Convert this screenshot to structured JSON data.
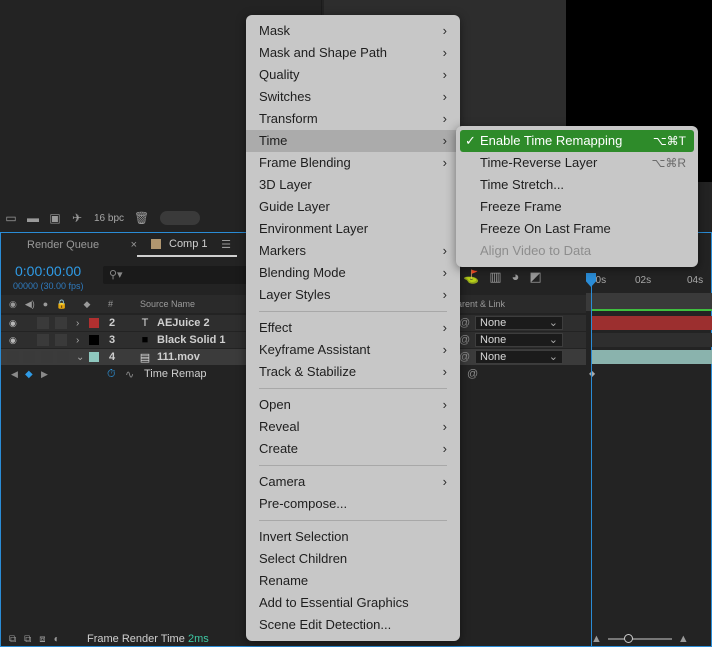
{
  "colors": {
    "accent_blue": "#2a8cd6",
    "menu_bg": "#c7c7c7",
    "highlight_green": "#2e8b2a",
    "label_red": "#b03030",
    "label_black": "#000000",
    "label_teal": "#8fc8bf"
  },
  "project_toolbar": {
    "bpc_label": "16 bpc"
  },
  "timeline": {
    "tabs": {
      "render_queue": "Render Queue",
      "comp": "Comp 1",
      "close_glyph": "×",
      "menu_glyph": "☰"
    },
    "timecode": "0:00:00:00",
    "fps": "00000 (30.00 fps)",
    "search_placeholder": "",
    "column_headers": {
      "number": "#",
      "source_name": "Source Name",
      "parent": "arent & Link"
    },
    "layers": [
      {
        "number": "2",
        "type_glyph": "T",
        "name": "AEJuice 2",
        "parent": "None"
      },
      {
        "number": "3",
        "type_glyph": "■",
        "name": "Black Solid 1",
        "parent": "None"
      },
      {
        "number": "4",
        "type_glyph": "▤",
        "name": "111.mov",
        "parent": "None"
      }
    ],
    "property_row": {
      "name": "Time Remap"
    },
    "ruler": [
      "00s",
      "02s",
      "04s"
    ],
    "footer": {
      "frame_render_label": "Frame Render Time",
      "frame_render_value": "2ms"
    }
  },
  "context_menu": {
    "groups": [
      [
        {
          "label": "Mask",
          "submenu": true
        },
        {
          "label": "Mask and Shape Path",
          "submenu": true
        },
        {
          "label": "Quality",
          "submenu": true
        },
        {
          "label": "Switches",
          "submenu": true
        },
        {
          "label": "Transform",
          "submenu": true
        },
        {
          "label": "Time",
          "submenu": true,
          "active": true
        },
        {
          "label": "Frame Blending",
          "submenu": true
        },
        {
          "label": "3D Layer",
          "submenu": false
        },
        {
          "label": "Guide Layer",
          "submenu": false
        },
        {
          "label": "Environment Layer",
          "submenu": false
        },
        {
          "label": "Markers",
          "submenu": true
        },
        {
          "label": "Blending Mode",
          "submenu": true
        },
        {
          "label": "Layer Styles",
          "submenu": true
        }
      ],
      [
        {
          "label": "Effect",
          "submenu": true
        },
        {
          "label": "Keyframe Assistant",
          "submenu": true
        },
        {
          "label": "Track & Stabilize",
          "submenu": true
        }
      ],
      [
        {
          "label": "Open",
          "submenu": true
        },
        {
          "label": "Reveal",
          "submenu": true
        },
        {
          "label": "Create",
          "submenu": true
        }
      ],
      [
        {
          "label": "Camera",
          "submenu": true
        },
        {
          "label": "Pre-compose...",
          "submenu": false
        }
      ],
      [
        {
          "label": "Invert Selection",
          "submenu": false
        },
        {
          "label": "Select Children",
          "submenu": false
        },
        {
          "label": "Rename",
          "submenu": false
        },
        {
          "label": "Add to Essential Graphics",
          "submenu": false
        },
        {
          "label": "Scene Edit Detection...",
          "submenu": false
        }
      ]
    ]
  },
  "time_submenu": {
    "items": [
      {
        "label": "Enable Time Remapping",
        "shortcut": "⌥⌘T",
        "checked": true,
        "highlighted": true,
        "disabled": false
      },
      {
        "label": "Time-Reverse Layer",
        "shortcut": "⌥⌘R",
        "checked": false,
        "highlighted": false,
        "disabled": false
      },
      {
        "label": "Time Stretch...",
        "shortcut": "",
        "checked": false,
        "highlighted": false,
        "disabled": false
      },
      {
        "label": "Freeze Frame",
        "shortcut": "",
        "checked": false,
        "highlighted": false,
        "disabled": false
      },
      {
        "label": "Freeze On Last Frame",
        "shortcut": "",
        "checked": false,
        "highlighted": false,
        "disabled": false
      },
      {
        "label": "Align Video to Data",
        "shortcut": "",
        "checked": false,
        "highlighted": false,
        "disabled": true
      }
    ]
  }
}
